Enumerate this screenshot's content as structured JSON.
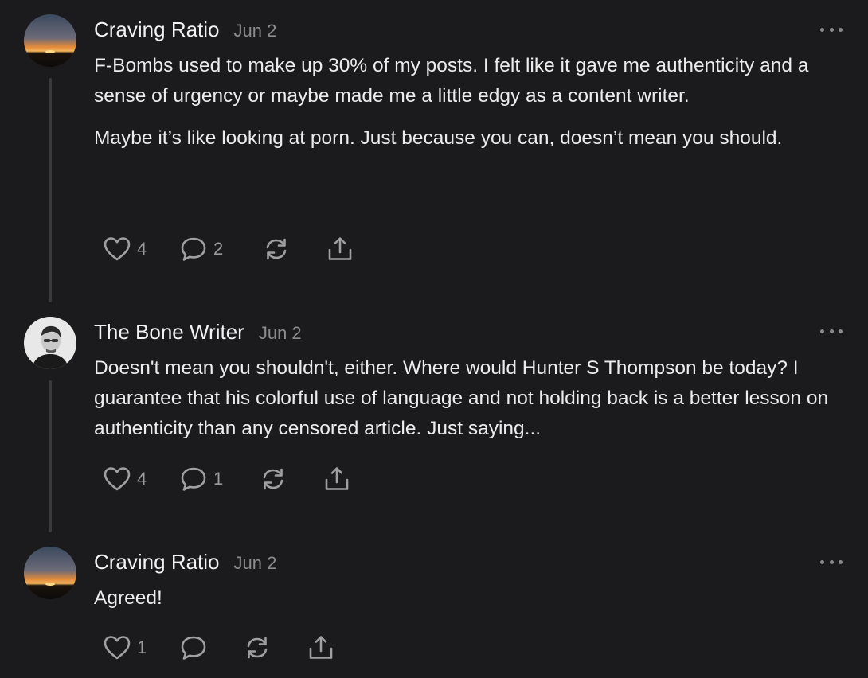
{
  "comments": [
    {
      "author": "Craving Ratio",
      "date": "Jun 2",
      "paragraphs": [
        "F-Bombs used to make up 30% of my posts. I felt like it gave me authenticity and a sense of urgency or maybe made me a little edgy as a content writer.",
        "Maybe it’s like looking at porn. Just because you can, doesn’t mean you should."
      ],
      "likes": "4",
      "replies": "2",
      "avatar": "sunset-photo"
    },
    {
      "author": "The Bone Writer",
      "date": "Jun 2",
      "paragraphs": [
        "Doesn't mean you shouldn't, either. Where would Hunter S Thompson be today? I guarantee that his colorful use of language and not holding back is a better lesson on authenticity than any censored article. Just saying..."
      ],
      "likes": "4",
      "replies": "1",
      "avatar": "man-portrait-photo"
    },
    {
      "author": "Craving Ratio",
      "date": "Jun 2",
      "paragraphs": [
        "Agreed!"
      ],
      "likes": "1",
      "replies": "",
      "avatar": "sunset-photo"
    }
  ],
  "icons": {
    "like": "heart-icon",
    "reply": "speech-bubble-icon",
    "restack": "restack-icon",
    "share": "share-icon",
    "more": "more-icon"
  },
  "colors": {
    "background": "#1b1b1d",
    "text": "#ececec",
    "muted": "#8c8c8e",
    "thread_line": "#3a3a3c"
  }
}
